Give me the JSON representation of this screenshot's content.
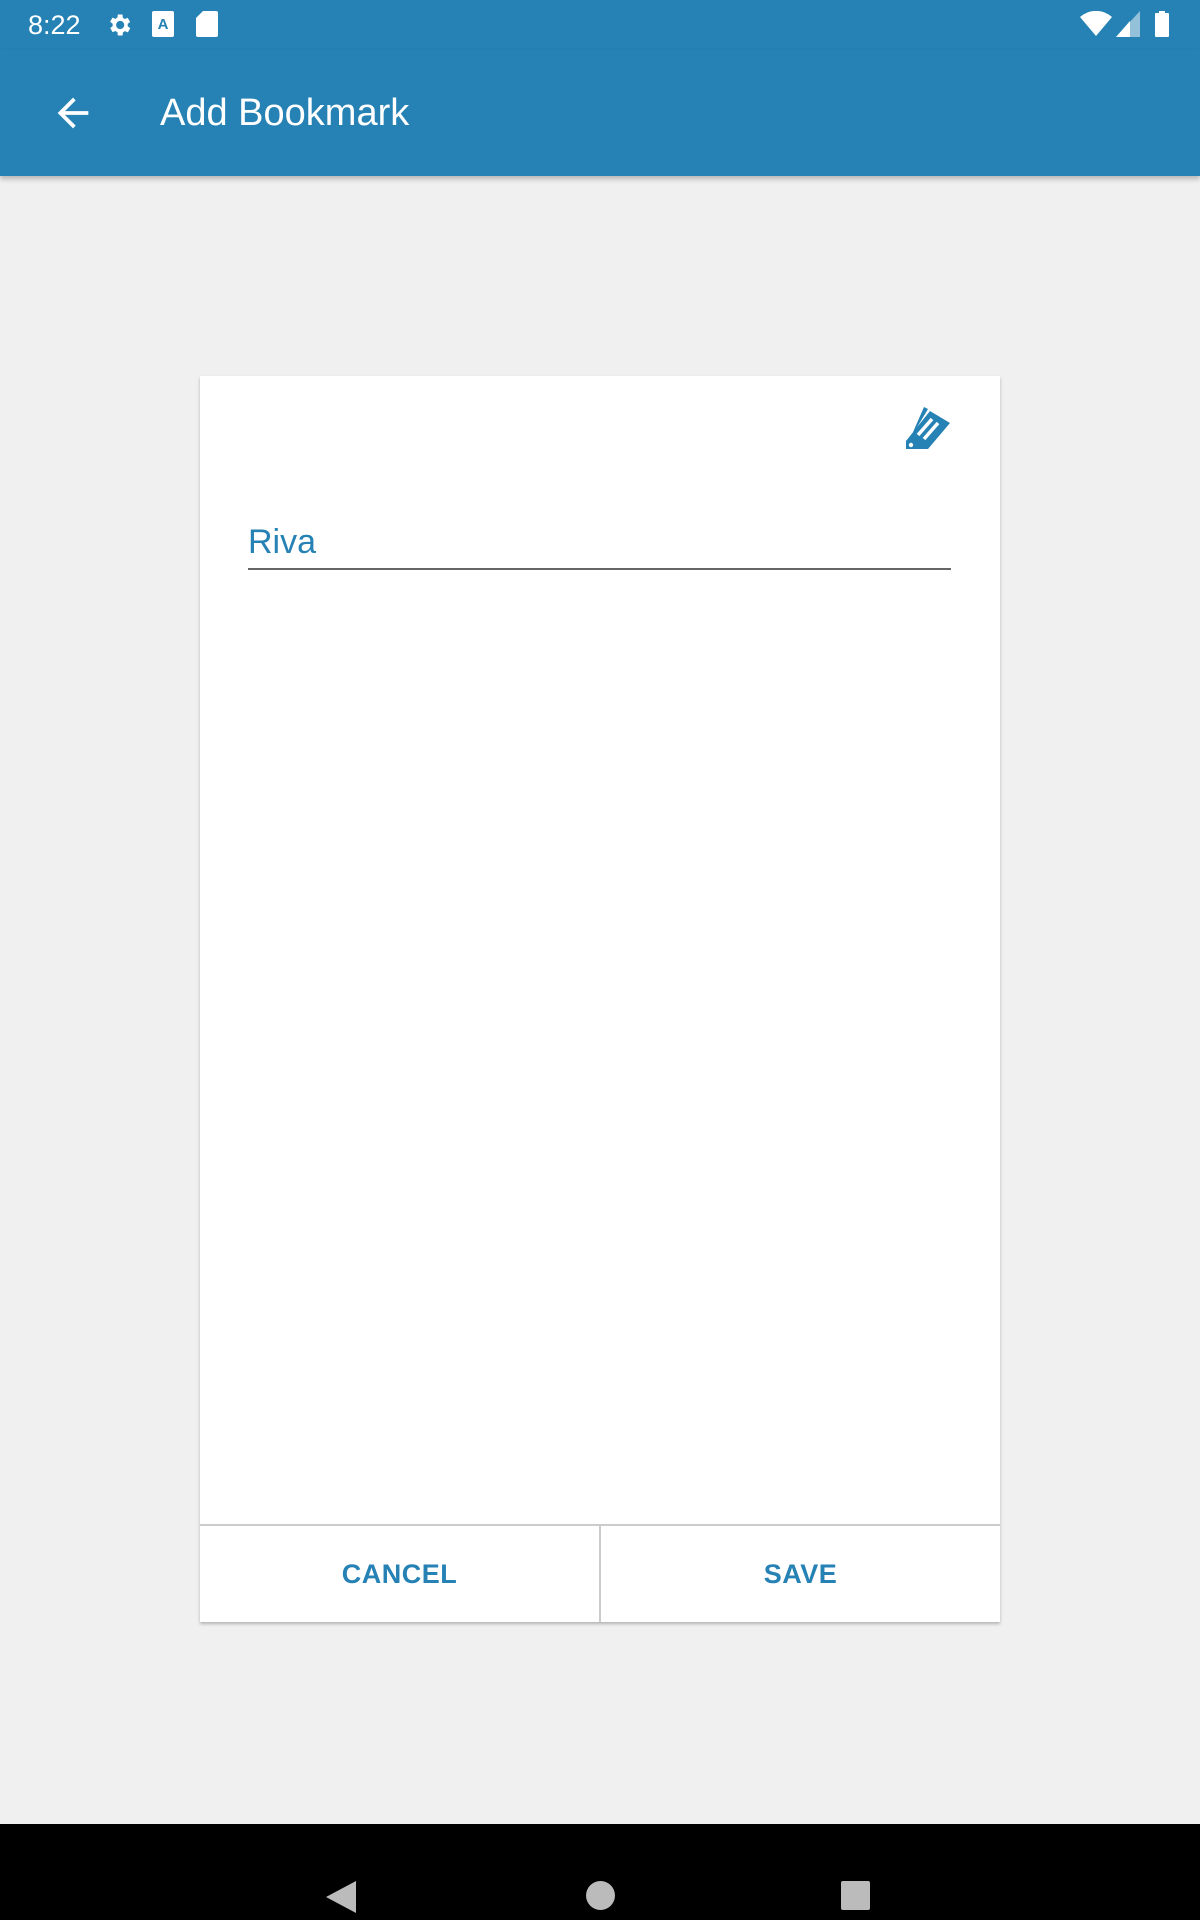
{
  "status_bar": {
    "time": "8:22",
    "icons": [
      "gear-icon",
      "font-download-icon",
      "sd-card-icon",
      "wifi-icon",
      "signal-icon",
      "battery-icon"
    ]
  },
  "app_bar": {
    "title": "Add Bookmark",
    "back_icon": "arrow-left-icon"
  },
  "dialog": {
    "icon": "tag-icon",
    "name_value": "Riva",
    "cancel_label": "CANCEL",
    "save_label": "SAVE"
  },
  "nav_bar": {
    "icons": [
      "back-triangle-icon",
      "home-circle-icon",
      "recents-square-icon"
    ]
  },
  "colors": {
    "primary": "#2682b4",
    "background": "#f0f0f0"
  }
}
